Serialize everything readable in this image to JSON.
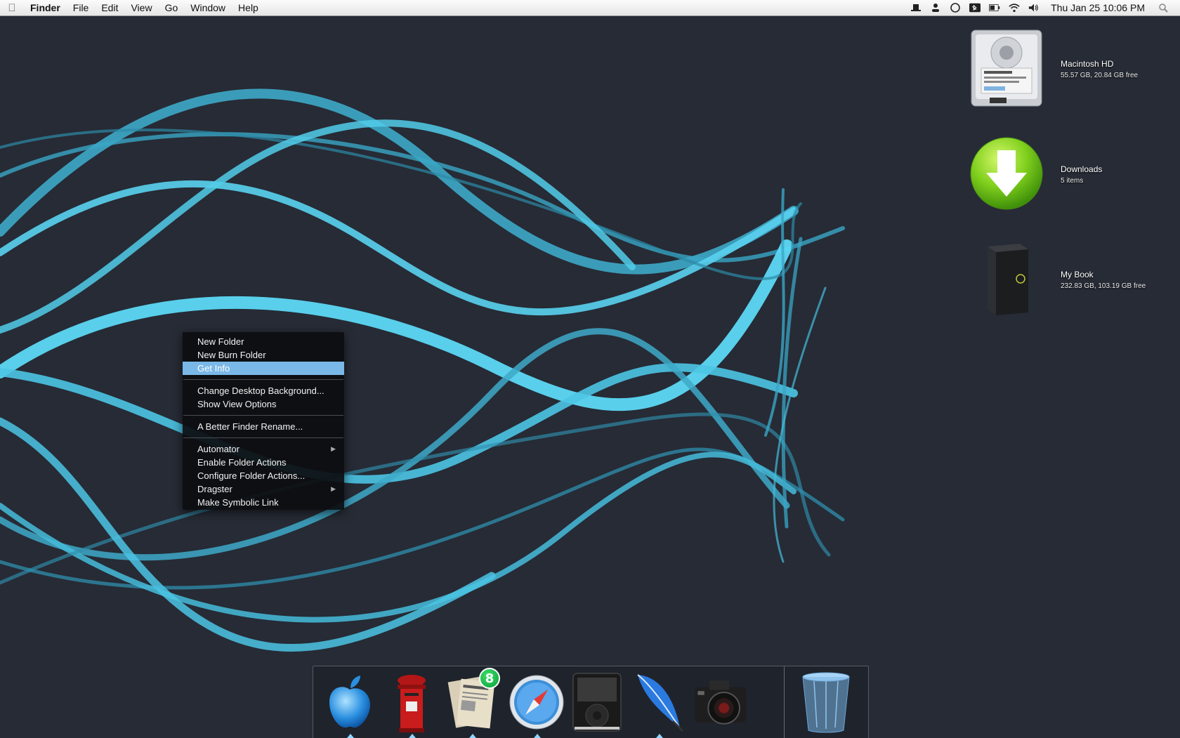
{
  "menubar": {
    "apple_icon": "apple-logo-icon",
    "menus": [
      "Finder",
      "File",
      "Edit",
      "View",
      "Go",
      "Window",
      "Help"
    ],
    "status_icons": [
      "hat-icon",
      "person-icon",
      "circle-status-icon",
      "bluetooth-icon",
      "battery-icon",
      "wifi-icon",
      "volume-icon"
    ],
    "clock": "Thu Jan 25 10:06 PM",
    "spotlight_icon": "spotlight-search-icon"
  },
  "desktop": {
    "items": [
      {
        "name": "Macintosh HD",
        "detail": "55.57 GB, 20.84 GB free",
        "icon": "hard-drive-icon"
      },
      {
        "name": "Downloads",
        "detail": "5 items",
        "icon": "downloads-folder-icon"
      },
      {
        "name": "My Book",
        "detail": "232.83 GB, 103.19 GB free",
        "icon": "external-drive-icon"
      }
    ]
  },
  "context_menu": {
    "groups": [
      [
        "New Folder",
        "New Burn Folder",
        "Get Info"
      ],
      [
        "Change Desktop Background...",
        "Show View Options"
      ],
      [
        "A Better Finder Rename..."
      ],
      [
        "Automator",
        "Enable Folder Actions",
        "Configure Folder Actions...",
        "Dragster",
        "Make Symbolic Link"
      ]
    ],
    "selected": "Get Info",
    "submenu_items": [
      "Automator",
      "Dragster"
    ]
  },
  "dock": {
    "apps": [
      {
        "name": "Finder",
        "icon": "apple-finder-icon",
        "running": true
      },
      {
        "name": "Mail",
        "icon": "postbox-mail-icon",
        "running": true
      },
      {
        "name": "News Reader",
        "icon": "newspaper-icon",
        "running": true,
        "badge": "8"
      },
      {
        "name": "Safari",
        "icon": "safari-compass-icon",
        "running": true
      },
      {
        "name": "iTunes",
        "icon": "ipod-icon",
        "running": false
      },
      {
        "name": "Feather",
        "icon": "feather-quill-icon",
        "running": true
      },
      {
        "name": "Camera",
        "icon": "camera-icon",
        "running": false
      }
    ],
    "trash": {
      "name": "Trash",
      "icon": "trash-icon"
    }
  }
}
